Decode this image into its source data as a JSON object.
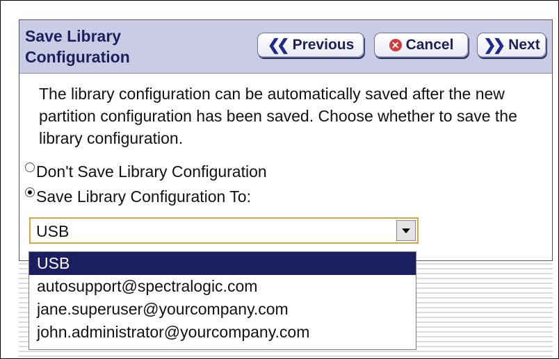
{
  "header": {
    "title": "Save Library Configuration",
    "buttons": {
      "previous": "Previous",
      "cancel": "Cancel",
      "next": "Next"
    }
  },
  "description": "The library configuration can be automatically saved after the new partition configuration has been saved. Choose whether to save the library configuration.",
  "radios": [
    {
      "label": "Don't Save Library Configuration",
      "checked": false
    },
    {
      "label": "Save Library Configuration To:",
      "checked": true
    }
  ],
  "destination_select": {
    "value": "USB",
    "options": [
      "USB",
      "autosupport@spectralogic.com",
      "jane.superuser@yourcompany.com",
      "john.administrator@yourcompany.com"
    ],
    "highlighted": "USB"
  },
  "colors": {
    "header_bg": "#c9cce4",
    "title_text": "#1c1f5c",
    "selected_option_bg": "#1b1f5f",
    "select_border": "#d9a93c"
  }
}
